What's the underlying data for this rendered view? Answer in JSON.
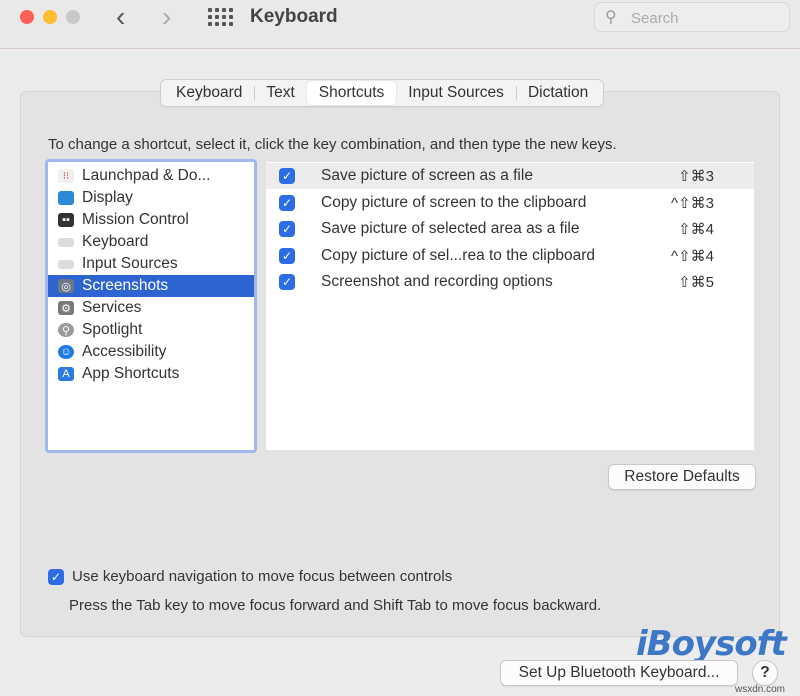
{
  "window": {
    "title": "Keyboard"
  },
  "search": {
    "placeholder": "Search"
  },
  "tabs": [
    {
      "label": "Keyboard",
      "active": false
    },
    {
      "label": "Text",
      "active": false
    },
    {
      "label": "Shortcuts",
      "active": true
    },
    {
      "label": "Input Sources",
      "active": false
    },
    {
      "label": "Dictation",
      "active": false
    }
  ],
  "instruction": "To change a shortcut, select it, click the key combination, and then type the new keys.",
  "categories": [
    {
      "label": "Launchpad & Do...",
      "icon": "launchpad-icon",
      "color": "#e8e8e8"
    },
    {
      "label": "Display",
      "icon": "display-icon",
      "color": "#2b8ad8"
    },
    {
      "label": "Mission Control",
      "icon": "mission-control-icon",
      "color": "#333333"
    },
    {
      "label": "Keyboard",
      "icon": "keyboard-icon",
      "color": "#d8d8d8"
    },
    {
      "label": "Input Sources",
      "icon": "input-sources-icon",
      "color": "#d8d8d8"
    },
    {
      "label": "Screenshots",
      "icon": "screenshots-icon",
      "color": "#6d7a8a",
      "selected": true
    },
    {
      "label": "Services",
      "icon": "gear-icon",
      "color": "#7a7a7a"
    },
    {
      "label": "Spotlight",
      "icon": "spotlight-icon",
      "color": "#8a8a8a"
    },
    {
      "label": "Accessibility",
      "icon": "accessibility-icon",
      "color": "#1e7ae0"
    },
    {
      "label": "App Shortcuts",
      "icon": "app-shortcuts-icon",
      "color": "#2c7be5"
    }
  ],
  "shortcuts": [
    {
      "label": "Save picture of screen as a file",
      "key": "⇧⌘3",
      "checked": true
    },
    {
      "label": "Copy picture of screen to the clipboard",
      "key": "^⇧⌘3",
      "checked": true
    },
    {
      "label": "Save picture of selected area as a file",
      "key": "⇧⌘4",
      "checked": true
    },
    {
      "label": "Copy picture of sel...rea to the clipboard",
      "key": "^⇧⌘4",
      "checked": true
    },
    {
      "label": "Screenshot and recording options",
      "key": "⇧⌘5",
      "checked": true
    }
  ],
  "restore_label": "Restore Defaults",
  "kbnav": {
    "label": "Use keyboard navigation to move focus between controls",
    "checked": true,
    "hint": "Press the Tab key to move focus forward and Shift Tab to move focus backward."
  },
  "bluetooth_label": "Set Up Bluetooth Keyboard...",
  "help_label": "?",
  "watermark": "iBoysoft",
  "site": "wsxdn.com",
  "colors": {
    "accent": "#2e64d0",
    "checkbox": "#2e6ce6"
  }
}
